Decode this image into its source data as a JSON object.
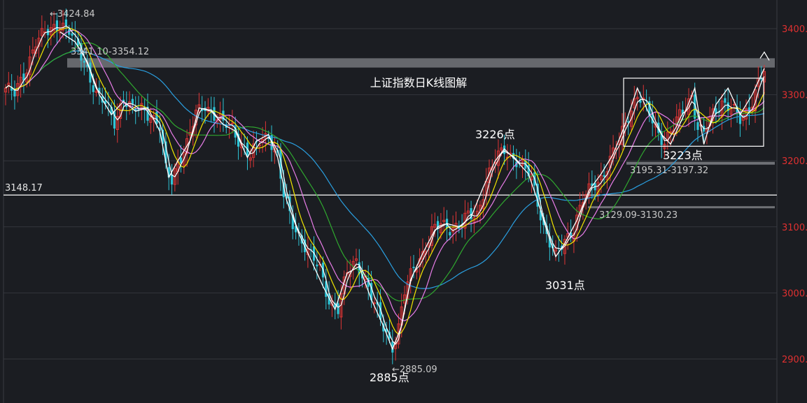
{
  "chart_data": {
    "type": "candlestick",
    "title": "上证指数日K线图解",
    "y_ticks": [
      {
        "value": 3400,
        "label": "3400."
      },
      {
        "value": 3300,
        "label": "3300."
      },
      {
        "value": 3200,
        "label": "3200."
      },
      {
        "value": 3100,
        "label": "3100."
      },
      {
        "value": 3000,
        "label": "3000."
      },
      {
        "value": 2900,
        "label": "2900."
      }
    ],
    "ylim": [
      2840,
      3460
    ],
    "high_label": "←3424.84",
    "low_label": "←2885.09",
    "reference_line": {
      "value": 3148.17,
      "label": "3148.17"
    },
    "zones": [
      {
        "from": 3341.1,
        "to": 3354.12,
        "label": "3341.10-3354.12"
      },
      {
        "from": 3195.31,
        "to": 3197.32,
        "label": "3195.31-3197.32"
      },
      {
        "from": 3129.09,
        "to": 3130.23,
        "label": "3129.09-3130.23"
      }
    ],
    "annotations": [
      {
        "text": "3226点",
        "value": 3226
      },
      {
        "text": "3031点",
        "value": 3031
      },
      {
        "text": "2885点",
        "value": 2885
      },
      {
        "text": "3223点",
        "value": 3223
      }
    ],
    "colors": {
      "up": "#e13535",
      "down": "#2ec4d6",
      "ma5": "#ffffff",
      "ma10": "#f2e600",
      "ma20": "#e87de8",
      "ma30": "#2fa82f",
      "ma60": "#2a9fe0",
      "reference": "#ffffff",
      "zone": "#6f7176"
    }
  }
}
